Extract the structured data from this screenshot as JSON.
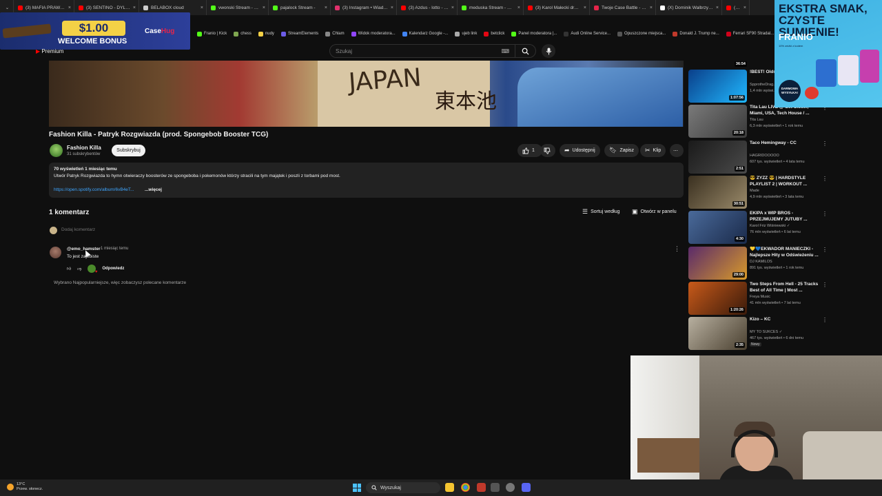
{
  "browser": {
    "tabs": [
      {
        "label": "(3) MAFIA PRAWDZ...",
        "icon": "youtube-icon",
        "color": "#ff0000"
      },
      {
        "label": "(3) SENTINO - DYLEM...",
        "icon": "youtube-icon",
        "color": "#ff0000"
      },
      {
        "label": "BELABOX cloud",
        "icon": "globe-icon",
        "color": "#cccccc"
      },
      {
        "label": "vwonski Stream - Wat...",
        "icon": "kick-icon",
        "color": "#53fc18"
      },
      {
        "label": "pajalock Stream -",
        "icon": "kick-icon",
        "color": "#53fc18"
      },
      {
        "label": "(3) Instagram • Wiadom...",
        "icon": "instagram-icon",
        "color": "#e1306c"
      },
      {
        "label": "(3) Azdus - lotto - You...",
        "icon": "youtube-icon",
        "color": "#ff0000"
      },
      {
        "label": "meduska Stream - Wa...",
        "icon": "kick-icon",
        "color": "#53fc18"
      },
      {
        "label": "(3) Karol Małecki drze...",
        "icon": "youtube-icon",
        "color": "#ff0000"
      },
      {
        "label": "Twoje Case Battle - W...",
        "icon": "casehug-icon",
        "color": "#e6254a"
      },
      {
        "label": "(X) Dominik Walbrzyc...",
        "icon": "x-icon",
        "color": "#ffffff"
      },
      {
        "label": "(3) Fashion K...",
        "icon": "youtube-icon",
        "color": "#ff0000"
      }
    ],
    "bookmarks": [
      {
        "label": "Franio | Kick",
        "color": "#53fc18"
      },
      {
        "label": "chess",
        "color": "#7fa650"
      },
      {
        "label": "nudy",
        "color": "#f4d146"
      },
      {
        "label": "StreamElements",
        "color": "#6c5ce7"
      },
      {
        "label": "Chlam",
        "color": "#888888"
      },
      {
        "label": "Widok moderatora...",
        "color": "#9146ff"
      },
      {
        "label": "Kalendarz Google -...",
        "color": "#4285f4"
      },
      {
        "label": "ujeb link",
        "color": "#aaaaaa"
      },
      {
        "label": "betclick",
        "color": "#e30613"
      },
      {
        "label": "Panel moderatora |...",
        "color": "#53fc18"
      },
      {
        "label": "Audi Online Service...",
        "color": "#333333"
      },
      {
        "label": "Opuszczone miejsca...",
        "color": "#555555"
      },
      {
        "label": "Donald J. Trump ne...",
        "color": "#c0392b"
      },
      {
        "label": "Ferrari SF90 Stradal...",
        "color": "#d0021b"
      }
    ]
  },
  "promo": {
    "amount": "$1.00",
    "text": "WELCOME BONUS",
    "brand_prefix": "Case",
    "brand_suffix": "Hug"
  },
  "youtube": {
    "premium_label": "Premium",
    "search_placeholder": "Szukaj",
    "video_title": "Fashion Killa - Patryk Rozgwiazda (prod. Spongebob Booster TCG)",
    "video_overlay_text": "JAPAN",
    "video_overlay_kanji": "東本池",
    "channel": {
      "name": "Fashion Killa",
      "subscribers": "31 subskrybentów",
      "subscribe_label": "Subskrybuj"
    },
    "actions": {
      "likes": "1",
      "share": "Udostępnij",
      "save": "Zapisz",
      "clip": "Klip"
    },
    "description": {
      "meta": "70 wyświetleń  1 miesiąc temu",
      "text": "Utwór Patryk Rozgwiazda to hymn otwieraczy boosterów ze spongeboba i pokemonów którzy stracili na tym majątek i poszli z torbami pod most.",
      "link": "https://open.spotify.com/album/6vB4eT...",
      "more": "...więcej"
    },
    "comments": {
      "count_label": "1 komentarz",
      "sort_label": "Sortuj według",
      "panel_label": "Otwórz w panelu",
      "add_placeholder": "Dodaj komentarz",
      "items": [
        {
          "author": "@emo_hamster",
          "time": "1 miesiąc temu",
          "text": "To jest zajebiste",
          "reply_label": "Odpowiedz"
        }
      ],
      "popular_note": "Wybrano Najpopularniejsze, więc zobaczysz polecane komentarze"
    },
    "recommended": [
      {
        "title": "!BEST! Olds... Hands Up, T...",
        "channel": "SpprotheDrag...",
        "views": "1,4 mln wyświ...",
        "duration": "1:07:56",
        "top_duration": "36:54",
        "colors": [
          "#0a3f8a",
          "#20b8ff"
        ]
      },
      {
        "title": "Tita Lau LIVE @ Get Closer, Miami, USA, Tech House / ...",
        "channel": "Tita Lau",
        "views": "6,3 mln wyświetleń • 1 rok temu",
        "duration": "20:18",
        "colors": [
          "#7a7a7a",
          "#3a3a3a"
        ]
      },
      {
        "title": "Taco Hemingway - CC",
        "channel": "HAGRIDOOOOO",
        "views": "607 tys. wyświetleń • 4 lata temu",
        "duration": "2:51",
        "colors": [
          "#1a1a1a",
          "#4a4a4a"
        ]
      },
      {
        "title": "😎 ZYZZ 😎 | HARDSTYLE PLAYLIST 2 | WORKOUT ...",
        "channel": "Made",
        "views": "4,9 mln wyświetleń • 3 lata temu",
        "duration": "30:51",
        "colors": [
          "#3a3020",
          "#9a8a6a"
        ]
      },
      {
        "title": "EKIPA x WIP BROS - PRZEJMUJEMY JUTUBY ...",
        "channel": "Karol Friz Wiśniewski ✓",
        "views": "76 mln wyświetleń • 6 lat temu",
        "duration": "4:30",
        "colors": [
          "#4a6a9a",
          "#1a2a4a"
        ]
      },
      {
        "title": "💛💙EKWADOR MANIECZKI - Najlepsze Hity w Odświeżeniu ...",
        "channel": "DJ KAMILOS",
        "views": "891 tys. wyświetleń • 1 rok temu",
        "duration": "29:00",
        "colors": [
          "#5a2a6a",
          "#d89a2a"
        ]
      },
      {
        "title": "Two Steps From Hell - 25 Tracks Best of All Time | Most ...",
        "channel": "Freya Music",
        "views": "41 mln wyświetleń • 7 lat temu",
        "duration": "1:20:26",
        "colors": [
          "#c85a1a",
          "#3a1a0a"
        ]
      },
      {
        "title": "Kizo – KC",
        "channel": "MY TO SUKCES ✓",
        "views": "467 tys. wyświetleń • 6 dni temu",
        "duration": "2:35",
        "new_badge": "Nowy",
        "colors": [
          "#b8b0a0",
          "#4a4030"
        ]
      }
    ]
  },
  "ad": {
    "headline": "EKSTRA SMAK, CZYSTE SUMIENIE!",
    "brand": "FRANIO",
    "sub": "10% zniżki z kodem",
    "badge": "DARMOWA WYSYŁKA!"
  },
  "taskbar": {
    "weather_temp": "13°C",
    "weather_desc": "Przew. słonecz.",
    "search_label": "Wyszukaj"
  }
}
